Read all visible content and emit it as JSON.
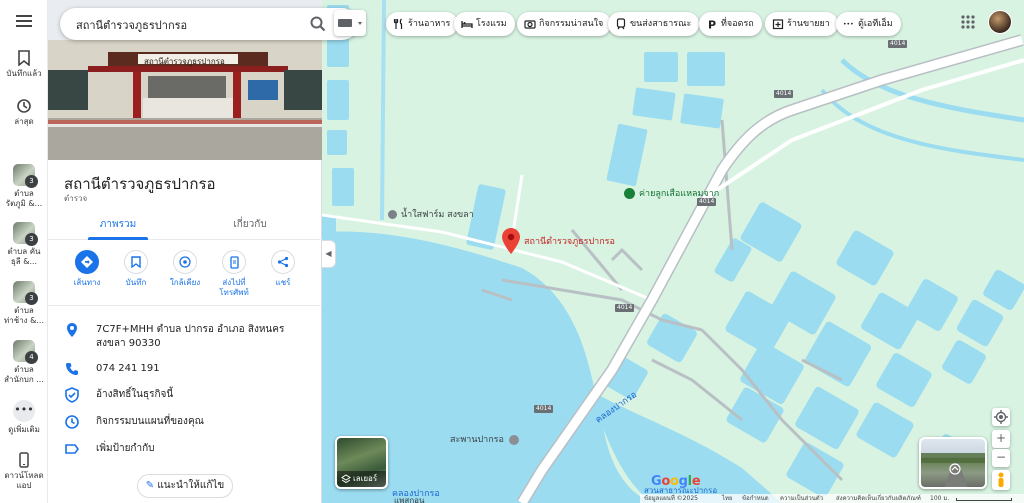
{
  "search": {
    "query": "สถานีตำรวจภูธรปากรอ"
  },
  "rail": {
    "saved": "บันทึกแล้ว",
    "recent": "ล่าสุด",
    "history": [
      {
        "label": "ตำบล\nรัตภูมิ &...",
        "count": "3"
      },
      {
        "label": "ตำบล คัน\nธุลี &...",
        "count": "3"
      },
      {
        "label": "ตำบล\nท่าช้าง &...",
        "count": "3"
      },
      {
        "label": "ตำบล\nสำนักบก ...",
        "count": "4"
      }
    ],
    "more": "ดูเพิ่มเติม",
    "download": "ดาวน์โหลด\nแอป"
  },
  "hero": {
    "sign_text": "สถานีตำรวจภูธรปากรอ"
  },
  "place": {
    "title": "สถานีตำรวจภูธรปากรอ",
    "category": "ตำรวจ"
  },
  "tabs": [
    {
      "label": "ภาพรวม"
    },
    {
      "label": "เกี่ยวกับ"
    }
  ],
  "actions": [
    {
      "label": "เส้นทาง"
    },
    {
      "label": "บันทึก"
    },
    {
      "label": "ใกล้เคียง"
    },
    {
      "label": "ส่งไปที่\nโทรศัพท์"
    },
    {
      "label": "แชร์"
    }
  ],
  "info": {
    "address": "7C7F+MHH ตำบล ปากรอ อำเภอ สิงหนคร สงขลา 90330",
    "phone": "074 241 191",
    "claim": "อ้างสิทธิ์ในธุรกิจนี้",
    "activity": "กิจกรรมบนแผนที่ของคุณ",
    "label": "เพิ่มป้ายกำกับ"
  },
  "suggest": "แนะนำให้แก้ไข",
  "chips": [
    {
      "label": "ร้านอาหาร",
      "icon": "fork-knife-icon"
    },
    {
      "label": "โรงแรม",
      "icon": "bed-icon"
    },
    {
      "label": "กิจกรรมน่าสนใจ",
      "icon": "camera-icon"
    },
    {
      "label": "ขนส่งสาธารณะ",
      "icon": "train-icon"
    },
    {
      "label": "ที่จอดรถ",
      "icon": "parking-icon"
    },
    {
      "label": "ร้านขายยา",
      "icon": "pharmacy-icon"
    },
    {
      "label": "ตู้เอทีเอ็ม",
      "icon": "atm-icon"
    }
  ],
  "map": {
    "pin_label": "สถานีตำรวจภูธรปากรอ",
    "labels": {
      "camp": "ค่ายลูกเสือแหลมจาก",
      "farm": "น้ำใสฟาร์ม สงขลา",
      "canal1": "คลองปากรอ",
      "canal2": "คลองปากรอ",
      "bridge": "สะพานปากรอ",
      "canal3": "คลองปากรอ",
      "bottom_poi": "แพสุกอน",
      "lake": "สวนสาธารณะปากรอ"
    },
    "shields": [
      "4014",
      "4014",
      "4014",
      "4014",
      "4014"
    ],
    "layers_label": "เลเยอร์"
  },
  "footer": {
    "data": "ข้อมูลแผนที่ ©2025",
    "thai": "ไทย",
    "terms": "ข้อกำหนด",
    "privacy": "ความเป็นส่วนตัว",
    "feedback": "ส่งความคิดเห็นเกี่ยวกับผลิตภัณฑ์",
    "scale": "100 ม."
  },
  "colors": {
    "accent": "#1a73e8",
    "pin": "#ea4335",
    "water": "#9adcf0",
    "land": "#d9f5e3",
    "road": "#ffffff"
  }
}
